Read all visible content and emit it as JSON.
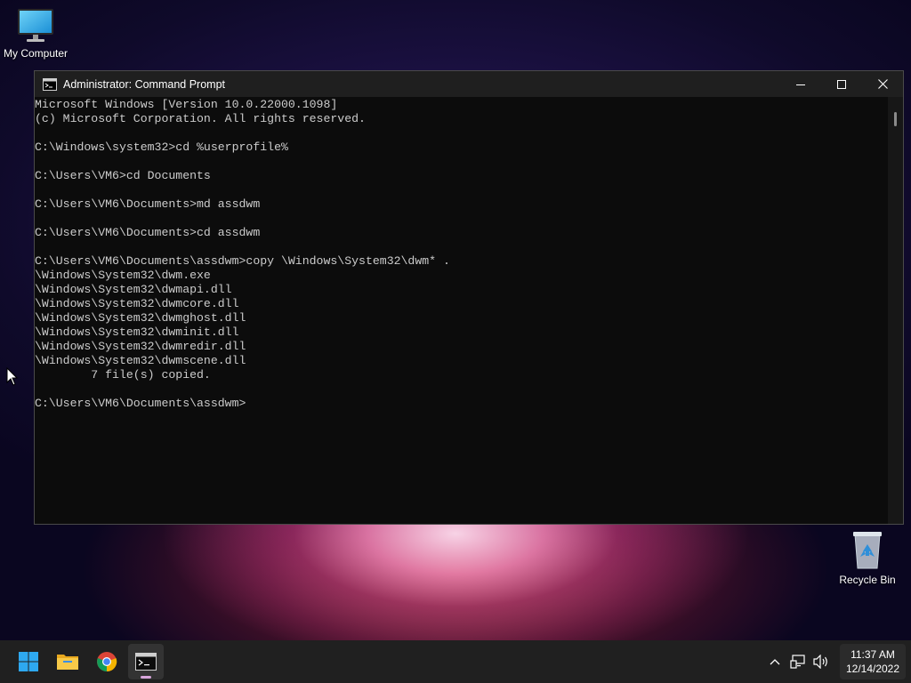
{
  "desktop": {
    "icons": [
      {
        "label": "My Computer",
        "icon": "monitor-icon"
      },
      {
        "label": "Recycle Bin",
        "icon": "recycle-bin-icon"
      }
    ]
  },
  "window": {
    "title": "Administrator: Command Prompt",
    "icon": "cmd-icon",
    "controls": [
      "minimize-icon",
      "maximize-icon",
      "close-icon"
    ],
    "lines": [
      "Microsoft Windows [Version 10.0.22000.1098]",
      "(c) Microsoft Corporation. All rights reserved.",
      "",
      "C:\\Windows\\system32>cd %userprofile%",
      "",
      "C:\\Users\\VM6>cd Documents",
      "",
      "C:\\Users\\VM6\\Documents>md assdwm",
      "",
      "C:\\Users\\VM6\\Documents>cd assdwm",
      "",
      "C:\\Users\\VM6\\Documents\\assdwm>copy \\Windows\\System32\\dwm* .",
      "\\Windows\\System32\\dwm.exe",
      "\\Windows\\System32\\dwmapi.dll",
      "\\Windows\\System32\\dwmcore.dll",
      "\\Windows\\System32\\dwmghost.dll",
      "\\Windows\\System32\\dwminit.dll",
      "\\Windows\\System32\\dwmredir.dll",
      "\\Windows\\System32\\dwmscene.dll",
      "        7 file(s) copied.",
      "",
      "C:\\Users\\VM6\\Documents\\assdwm>"
    ]
  },
  "taskbar": {
    "items": [
      "windows-start-icon",
      "file-explorer-icon",
      "chrome-icon",
      "terminal-icon"
    ],
    "tray": [
      "chevron-up-icon",
      "network-icon",
      "volume-icon"
    ],
    "time": "11:37 AM",
    "date": "12/14/2022"
  },
  "colors": {
    "console_bg": "#0c0c0c",
    "console_fg": "#cccccc",
    "titlebar_bg": "#1f1f1f",
    "taskbar_bg": "#202020"
  }
}
